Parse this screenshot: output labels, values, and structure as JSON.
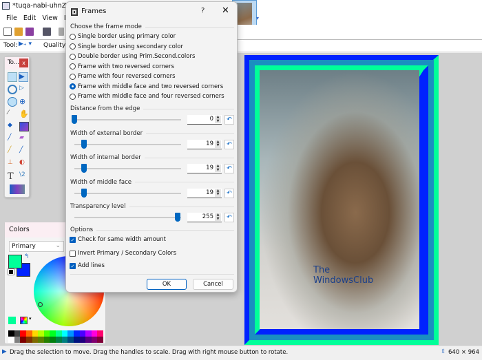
{
  "window": {
    "title": "*tuqa-nabi-uhnZZUa",
    "app_icon": "paint-icon"
  },
  "menu": [
    {
      "label": "File"
    },
    {
      "label": "Edit"
    },
    {
      "label": "View"
    },
    {
      "label": "Im"
    }
  ],
  "tool_options": {
    "tool_label": "Tool:",
    "quality_label": "Quality:"
  },
  "toolbox": {
    "title": "To...",
    "close": "x"
  },
  "colors_panel": {
    "title": "Colors",
    "mode": "Primary",
    "primary": "#00ff99",
    "secondary": "#0022ff",
    "palette": [
      "#000000",
      "#404040",
      "#ff0000",
      "#ff6a00",
      "#ffd800",
      "#b6ff00",
      "#4cff00",
      "#00ff21",
      "#00ff90",
      "#00ffff",
      "#0094ff",
      "#0026ff",
      "#4800ff",
      "#b200ff",
      "#ff00dc",
      "#ff006e",
      "#ffffff",
      "#808080",
      "#7f0000",
      "#7f3300",
      "#7f6a00",
      "#5b7f00",
      "#267f00",
      "#007f0e",
      "#007f46",
      "#007f7f",
      "#004a7f",
      "#00137f",
      "#21007f",
      "#57007f",
      "#7f006e",
      "#7f0037"
    ]
  },
  "dialog": {
    "title": "Frames",
    "help": "?",
    "close": "✕",
    "mode_section": "Choose the frame mode",
    "modes": [
      {
        "label": "Single border using primary color",
        "selected": false
      },
      {
        "label": "Single border using secondary color",
        "selected": false
      },
      {
        "label": "Double border using Prim.Second.colors",
        "selected": false
      },
      {
        "label": "Frame with two reversed corners",
        "selected": false
      },
      {
        "label": "Frame with four reversed corners",
        "selected": false
      },
      {
        "label": "Frame with middle face and two reversed corners",
        "selected": true
      },
      {
        "label": "Frame with middle face and four reversed corners",
        "selected": false
      }
    ],
    "sliders": [
      {
        "label": "Distance from the edge",
        "value": "0"
      },
      {
        "label": "Width of external border",
        "value": "19"
      },
      {
        "label": "Width of internal border",
        "value": "19"
      },
      {
        "label": "Width of middle face",
        "value": "19"
      },
      {
        "label": "Transparency level",
        "value": "255"
      }
    ],
    "options_section": "Options",
    "options": [
      {
        "label": "Check for same width amount",
        "checked": true
      },
      {
        "label": "Invert Primary / Secondary Colors",
        "checked": false
      },
      {
        "label": "Add lines",
        "checked": true
      }
    ],
    "ok": "OK",
    "cancel": "Cancel"
  },
  "canvas": {
    "frame_colors": {
      "outer": "#0022ff",
      "middle": "#1a8fc0",
      "inner": "#00ff99"
    },
    "watermark": "The WindowsClub"
  },
  "status": {
    "hint": "Drag the selection to move. Drag the handles to scale. Drag with right mouse button to rotate.",
    "size": "640 × 964"
  }
}
